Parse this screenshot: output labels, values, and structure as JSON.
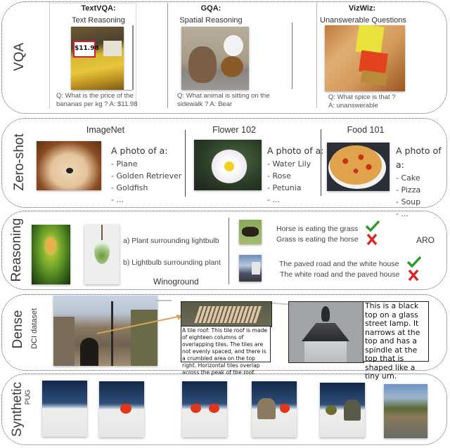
{
  "sections": {
    "vqa": {
      "label": "VQA",
      "items": [
        {
          "title": "TextVQA:",
          "subtitle": "Text Reasoning",
          "question": "Q: What is the price of the",
          "question2": "bananas per kg ? A: $11.98",
          "image_icon": "bananas-price-tag-photo",
          "price_tag": "$11.98"
        },
        {
          "title": "GQA:",
          "subtitle": "Spatial Reasoning",
          "question": "Q: What animal is sitting on the",
          "question2": "sidewalk ? A: Bear",
          "image_icon": "teddy-bears-photo"
        },
        {
          "title": "VizWiz:",
          "subtitle": "Unanswerable Questions",
          "question": "Q: What spice is that ?",
          "question2": "A: unanswerable",
          "image_icon": "spice-bottle-photo"
        }
      ]
    },
    "zeroshot": {
      "label": "Zero-shot",
      "datasets": [
        {
          "title": "ImageNet",
          "prompt": "A photo of a:",
          "options": [
            "- Plane",
            "- Golden Retriever",
            "- Goldfish",
            "- ..."
          ],
          "image_icon": "golden-retriever-photo"
        },
        {
          "title": "Flower 102",
          "prompt": "A photo of a:",
          "options": [
            "- Water Lily",
            "- Rose",
            "- Petunia",
            "- ..."
          ],
          "image_icon": "water-lily-photo"
        },
        {
          "title": "Food 101",
          "prompt": "A photo of a:",
          "options": [
            "- Cake",
            "- Pizza",
            "- Soup",
            "- ..."
          ],
          "image_icon": "pizza-photo"
        }
      ]
    },
    "reasoning": {
      "label": "Reasoning",
      "winoground": {
        "name": "Winoground",
        "option_a": "a) Plant surrounding lightbulb",
        "option_b": "b) Lightbulb surrounding plant",
        "images": [
          "lightbulb-in-plants-photo",
          "plant-in-lightbulb-photo"
        ]
      },
      "aro": {
        "name": "ARO",
        "pairs": [
          {
            "correct": "Horse is eating the grass",
            "wrong": "Grass is eating the horse",
            "image_icon": "horse-photo"
          },
          {
            "correct": "The paved road and the white house",
            "wrong": "The white road and the paved house",
            "image_icon": "street-house-photo"
          }
        ],
        "correct_color": "#2e9a2e",
        "wrong_color": "#d42a2a"
      }
    },
    "dense": {
      "label": "Dense",
      "sublabel": "DCI dataset",
      "caption1": "A tile roof: This tile roof is made of eighteen columns of overlapping tiles.  The tiles are not evenly spaced, and there is a crumbled area on the top right.  Horizontal tiles overlap across the peak of the roof.",
      "caption2": "This is a black top on a glass street lamp.  It narrows at the top and has a spindle at the top that is shaped like a tiny urn.",
      "arrow_color": "#d9a25a"
    },
    "synthetic": {
      "label": "Synthetic",
      "sublabel": "PUG",
      "images": [
        "empty-desert-scene",
        "goldfish-scene",
        "two-goldfish-scene",
        "elephant-goldfish-scene",
        "fish-elephant-scene",
        "forest-scene"
      ]
    }
  }
}
